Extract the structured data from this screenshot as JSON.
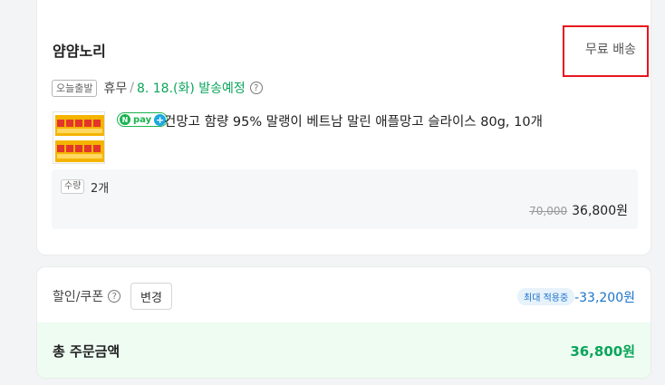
{
  "order": {
    "seller": "얌얌노리",
    "shipping_fee": "무료 배송",
    "delivery": {
      "tag": "오늘출발",
      "holiday": "휴무",
      "separator": "/",
      "date": "8. 18.(화) 발송예정"
    },
    "npay": {
      "n": "N",
      "text": "pay",
      "plus": "+"
    },
    "product_name": "건망고 함량 95% 말랭이 베트남 말린 애플망고 슬라이스 80g, 10개",
    "quantity_tag": "수량",
    "quantity": "2개",
    "original_price": "70,000",
    "final_price": "36,800원"
  },
  "discount": {
    "label": "할인/쿠폰",
    "change_label": "변경",
    "max_badge": "최대 적용중",
    "amount": "-33,200원"
  },
  "total": {
    "label": "총 주문금액",
    "value": "36,800원"
  },
  "colors": {
    "accent_green": "#0aa55a",
    "highlight_red": "#e8141e",
    "discount_blue": "#1a73c9"
  }
}
